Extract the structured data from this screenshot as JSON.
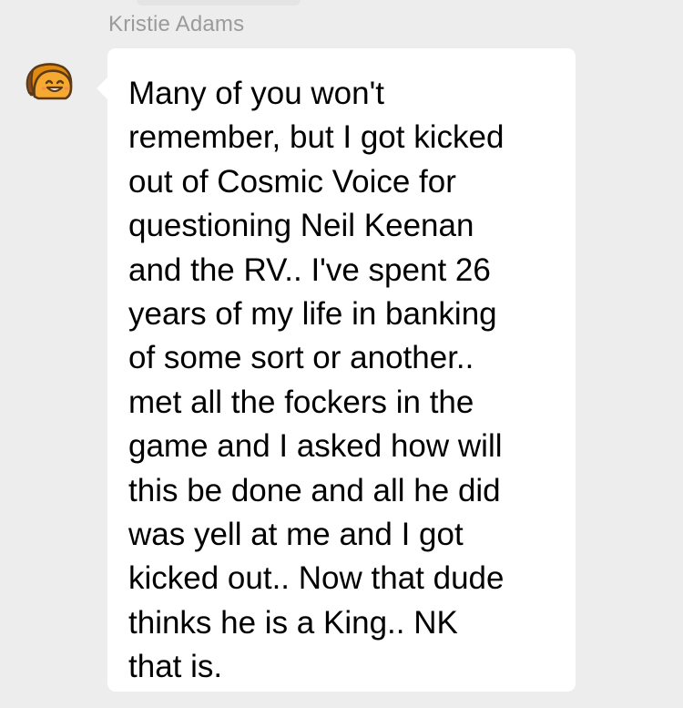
{
  "message": {
    "sender_name": "Kristie Adams",
    "avatar_icon": "smiling-taco-sticker-icon",
    "text": "Many of you won't\nremember, but I got kicked\nout of Cosmic Voice for\nquestioning Neil Keenan\nand the RV.. I've spent 26\nyears of my life in banking\nof some sort or another..\nmet all the fockers in the\ngame and I asked how will\nthis be done and all he did\nwas yell at me and I got\nkicked out.. Now that dude\nthinks he is a King.. NK\nthat is."
  },
  "colors": {
    "background": "#ededed",
    "bubble": "#ffffff",
    "sender_name": "#9b9b9b",
    "avatar_primary": "#f5a623",
    "avatar_outline": "#5a3a18"
  }
}
